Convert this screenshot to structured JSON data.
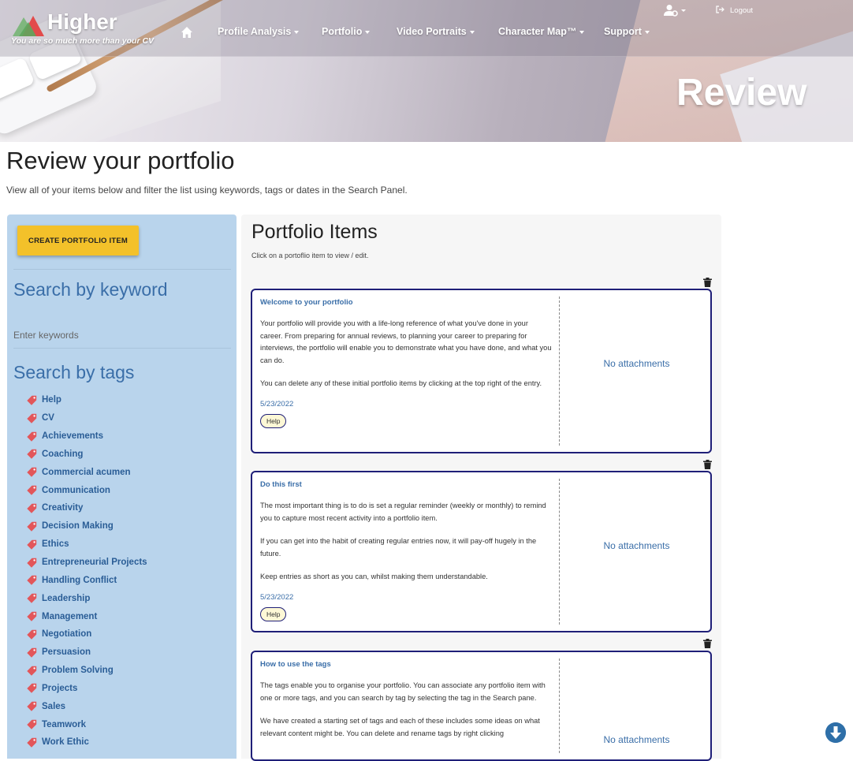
{
  "header": {
    "brand": "Higher",
    "tagline": "You are so much more than your CV",
    "nav": [
      {
        "label": "Profile Analysis"
      },
      {
        "label": "Portfolio"
      },
      {
        "label": "Video Portraits"
      },
      {
        "label": "Character Map™"
      },
      {
        "label": "Support"
      }
    ],
    "logout_label": "Logout",
    "hero_title": "Review"
  },
  "page": {
    "title": "Review your portfolio",
    "description": "View all of your items below and filter the list using keywords, tags or dates in the Search Panel."
  },
  "sidebar": {
    "create_label": "CREATE PORTFOLIO ITEM",
    "keyword_heading": "Search by keyword",
    "keyword_placeholder": "Enter keywords",
    "tags_heading": "Search by tags",
    "tags": [
      "Help",
      "CV",
      "Achievements",
      "Coaching",
      "Commercial acumen",
      "Communication",
      "Creativity",
      "Decision Making",
      "Ethics",
      "Entrepreneurial Projects",
      "Handling Conflict",
      "Leadership",
      "Management",
      "Negotiation",
      "Persuasion",
      "Problem Solving",
      "Projects",
      "Sales",
      "Teamwork",
      "Work Ethic"
    ]
  },
  "main": {
    "title": "Portfolio Items",
    "subtitle": "Click on a portoflio item to view / edit.",
    "items": [
      {
        "title": "Welcome to your portfolio",
        "paragraphs": [
          "Your portfolio will provide you with a life-long reference of what you've done in your career. From preparing for annual reviews, to planning your career to preparing for interviews, the portfolio will enable you to demonstrate what you have done, and what you can do.",
          "You can delete any of these initial portfolio items by clicking at the top right of the entry."
        ],
        "date": "5/23/2022",
        "tag": "Help",
        "attachments": "No attachments"
      },
      {
        "title": "Do this first",
        "paragraphs": [
          "The most important thing is to do is set a regular reminder (weekly or monthly) to remind you to capture most recent activity into a portfolio item.",
          "If you can get into the habit of creating regular entries now, it will pay-off hugely in the future.",
          "Keep entries as short as you can, whilst making them understandable."
        ],
        "date": "5/23/2022",
        "tag": "Help",
        "attachments": "No attachments"
      },
      {
        "title": "How to use the tags",
        "paragraphs": [
          "The tags enable you to organise your portfolio. You can associate any portfolio item with one or more tags, and you can search by tag by selecting the tag in the Search pane.",
          "We have created a starting set of tags and each of these includes some ideas on what relevant content might be. You can delete and rename tags by right clicking"
        ],
        "date": "",
        "tag": "",
        "attachments": "No attachments"
      }
    ]
  },
  "icons": {
    "home": "home-icon",
    "user": "user-cog-icon",
    "logout": "sign-out-icon",
    "tag": "tag-icon",
    "trash": "trash-icon",
    "scroll": "arrow-down-circle-icon"
  },
  "colors": {
    "sidebar_bg": "#b9d4ec",
    "accent_blue": "#3a6ea8",
    "create_button": "#f3c12a",
    "card_border": "#1f1f78"
  }
}
